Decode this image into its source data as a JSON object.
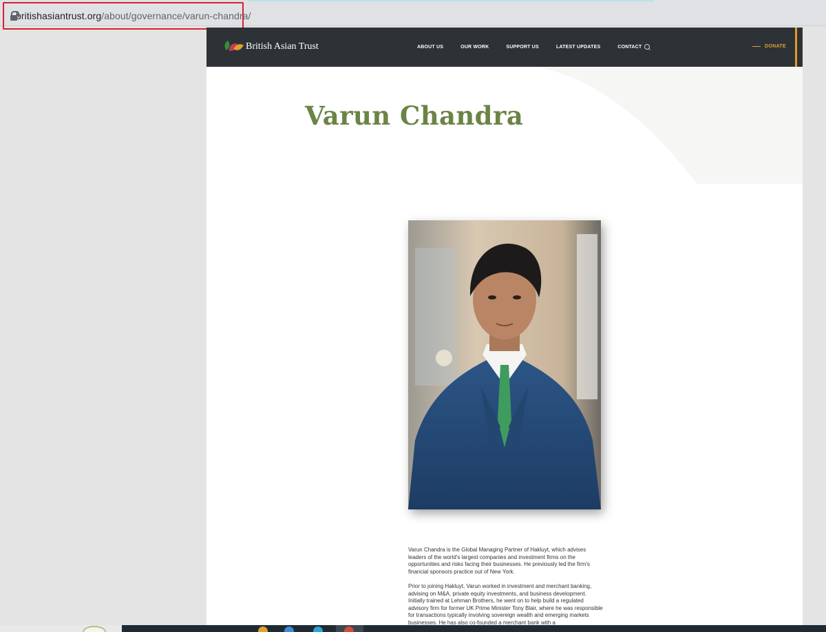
{
  "browser": {
    "url_domain": "britishasiantrust.org",
    "url_path": "/about/governance/varun-chandra/"
  },
  "site": {
    "logo_text": "British Asian Trust",
    "nav": [
      "ABOUT US",
      "OUR WORK",
      "SUPPORT US",
      "LATEST UPDATES",
      "CONTACT"
    ],
    "donate": "DONATE",
    "colors": {
      "navbar": "#2d3236",
      "accent": "#e39a2c",
      "title": "#6b8445"
    }
  },
  "page": {
    "title": "Varun Chandra",
    "bio": [
      "Varun Chandra is the Global Managing Partner of Hakluyt, which advises leaders of the world's largest companies and investment firms on the opportunities and risks facing their businesses. He previously led the firm's financial sponsors practice out of New York.",
      "Prior to joining Hakluyt, Varun worked in investment and merchant banking, advising on M&A, private equity investments, and business development. Initially trained at Lehman Brothers, he went on to help build a regulated advisory firm for former UK Prime Minister Tony Blair, where he was responsible for transactions typically involving sovereign wealth and emerging markets businesses. He has also co-founded a merchant bank with a"
    ]
  }
}
